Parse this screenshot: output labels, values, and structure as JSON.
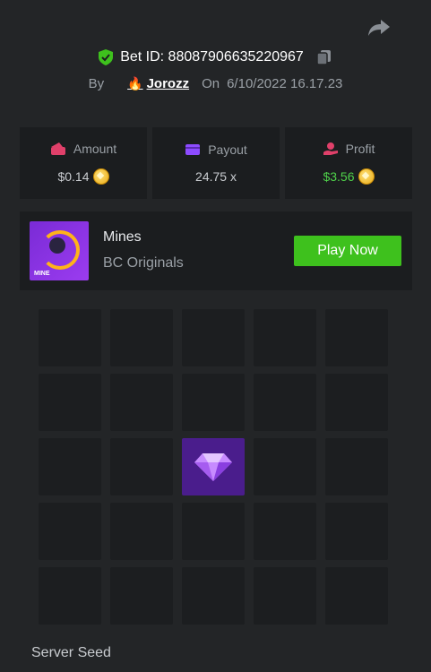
{
  "header": {
    "bet_id_label": "Bet ID: 88087906635220967",
    "by_label": "By",
    "username": "Jorozz",
    "on_label": "On",
    "timestamp": "6/10/2022 16.17.23"
  },
  "stats": [
    {
      "label": "Amount",
      "value": "$0.14",
      "icon": "wallet-icon",
      "coin": true
    },
    {
      "label": "Payout",
      "value": "24.75 x",
      "icon": "card-icon",
      "coin": false
    },
    {
      "label": "Profit",
      "value": "$3.56",
      "icon": "profit-hand-icon",
      "coin": true
    }
  ],
  "game": {
    "name": "Mines",
    "provider": "BC Originals",
    "play_label": "Play Now",
    "thumb_text": "MINE"
  },
  "board": {
    "rows": 5,
    "cols": 5,
    "revealed_gems": [
      [
        2,
        2
      ]
    ]
  },
  "footer": {
    "server_seed_label": "Server Seed"
  },
  "colors": {
    "background": "#232527",
    "card": "#1b1d1f",
    "play_button": "#3ec11d",
    "profit_text": "#4fd14a",
    "gem_tile": "#4a1d8c"
  }
}
